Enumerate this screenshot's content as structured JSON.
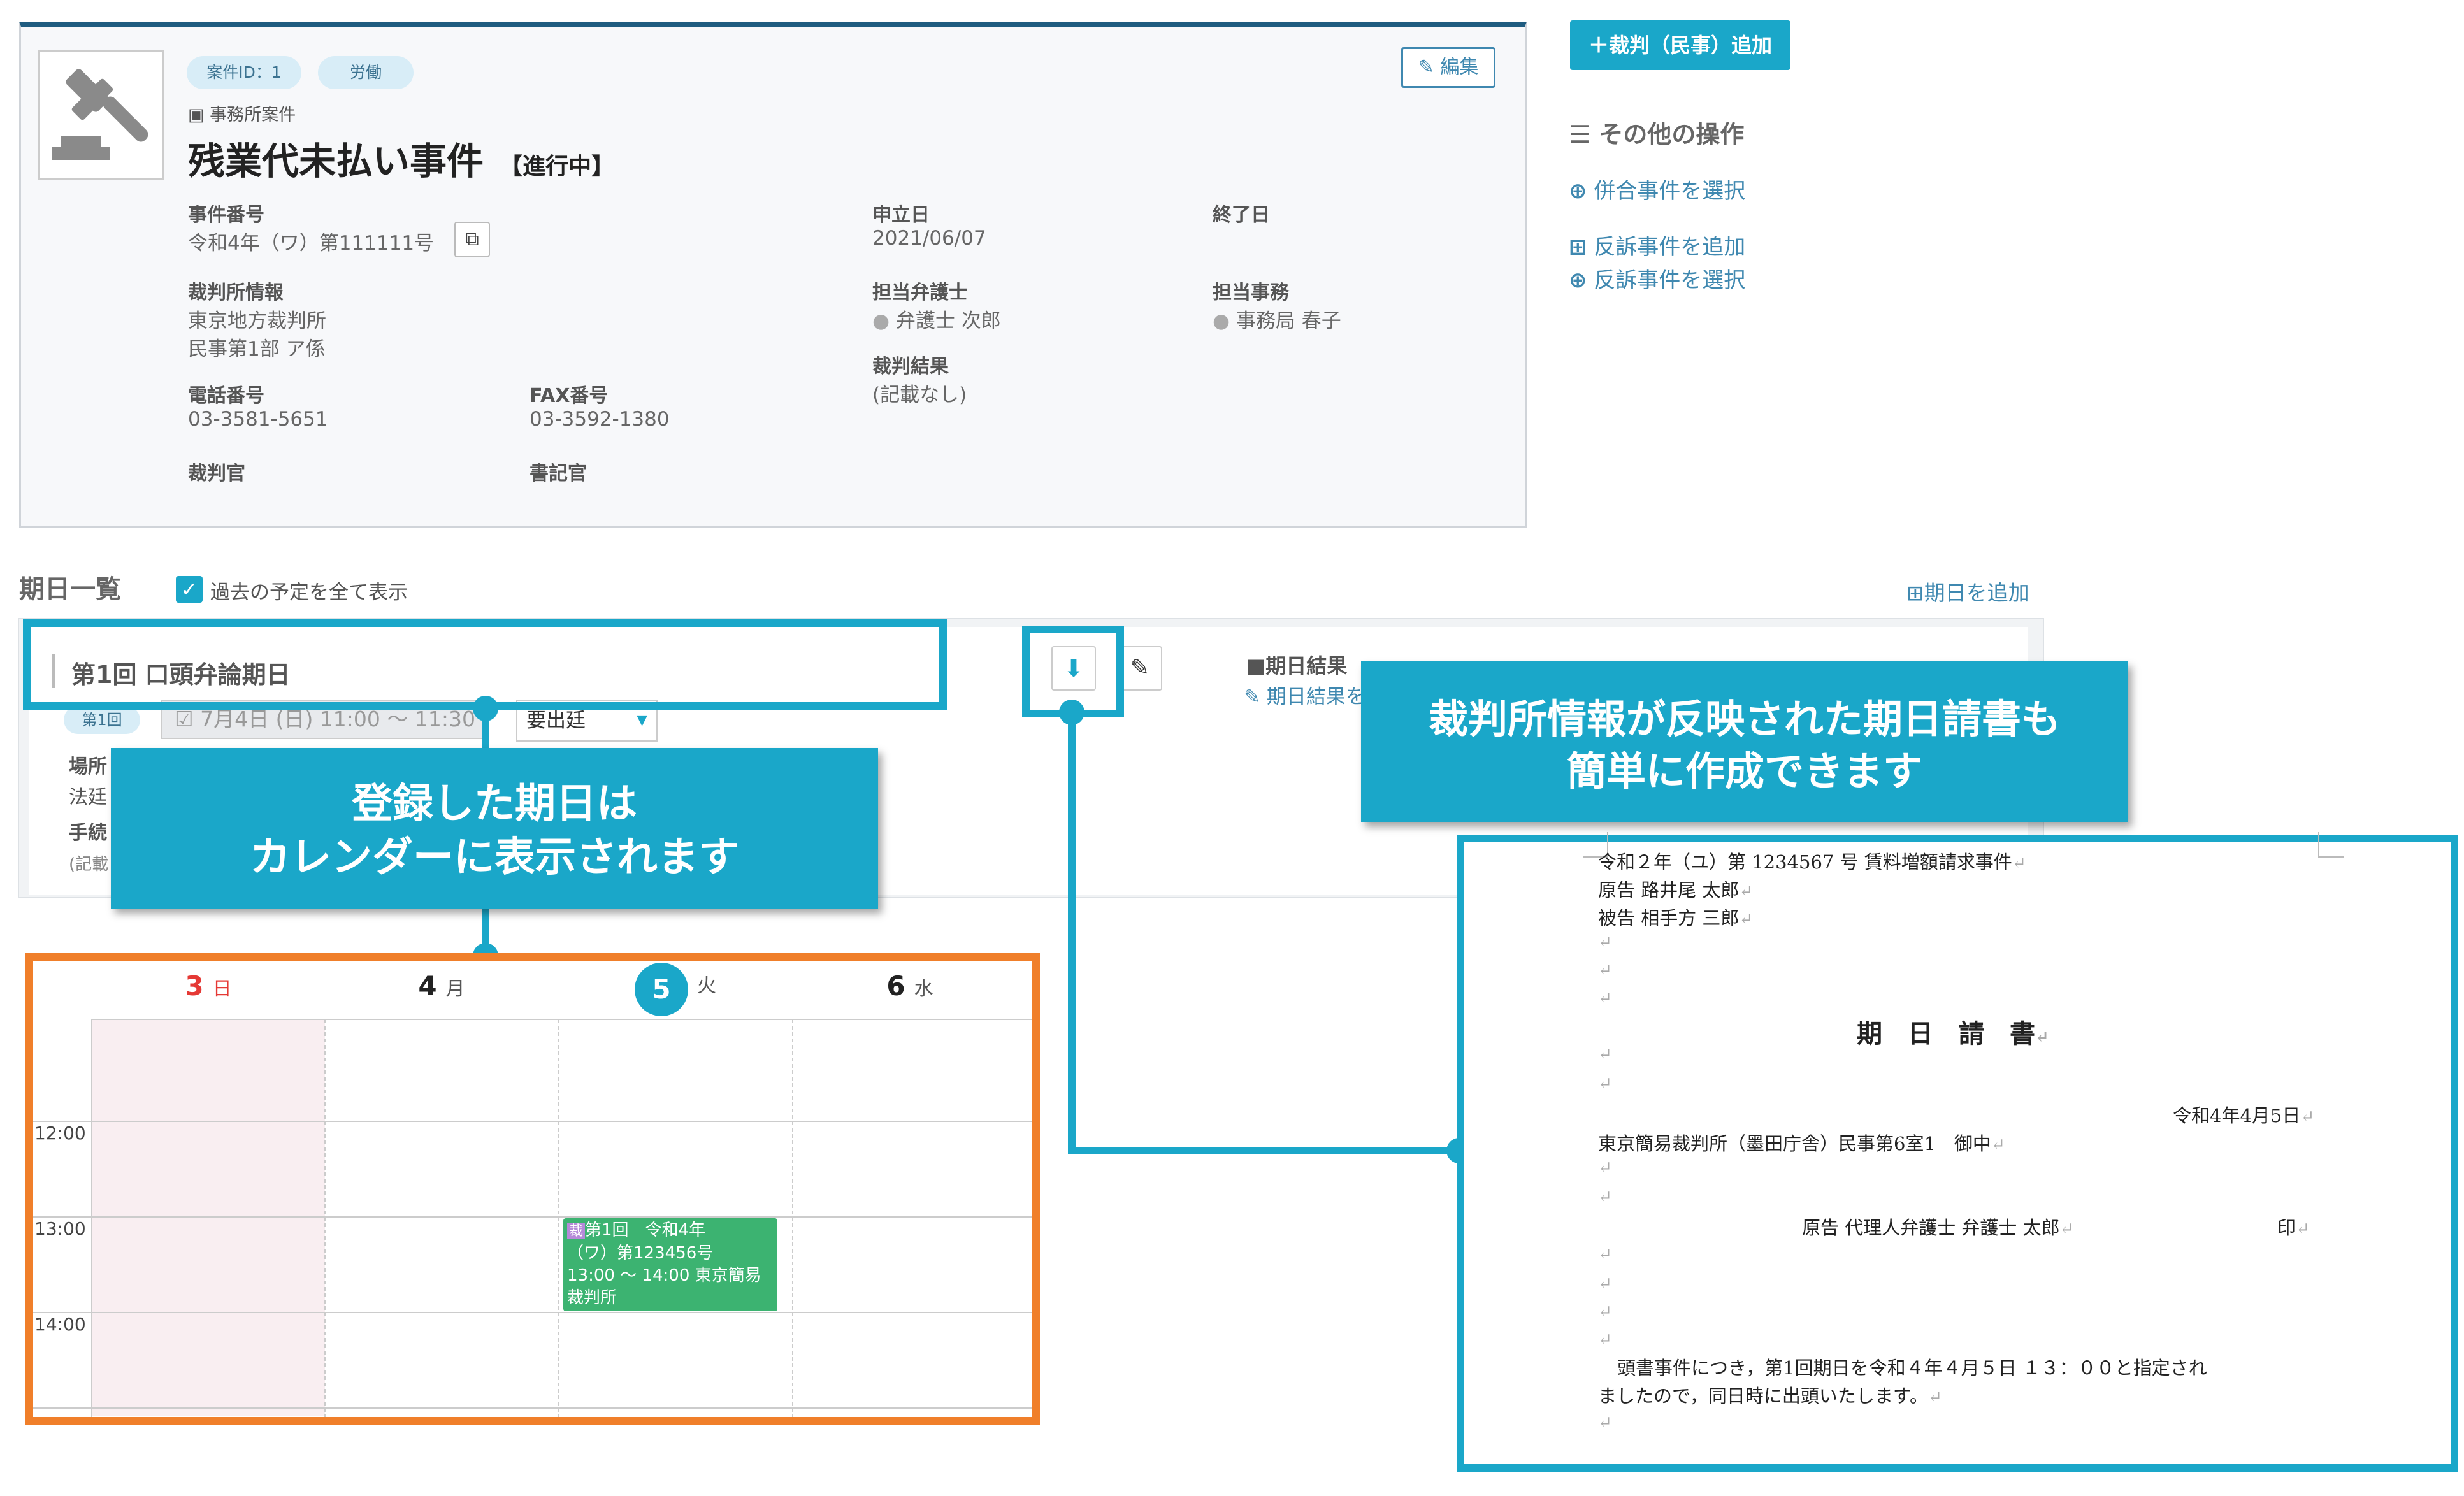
{
  "case": {
    "id_tag": "案件ID：1",
    "category_tag": "労働",
    "edit_label": "編集",
    "office_label": "事務所案件",
    "title": "残業代未払い事件",
    "status": "【進行中】",
    "fields": {
      "case_number_label": "事件番号",
      "case_number": "令和4年（ワ）第111111号",
      "filed_date_label": "申立日",
      "filed_date": "2021/06/07",
      "end_date_label": "終了日",
      "court_info_label": "裁判所情報",
      "court_name": "東京地方裁判所",
      "court_division": "民事第1部 ア係",
      "lawyer_label": "担当弁護士",
      "lawyer": "弁護士 次郎",
      "staff_label": "担当事務",
      "staff": "事務局 春子",
      "judgment_label": "裁判結果",
      "judgment": "(記載なし)",
      "phone_label": "電話番号",
      "phone": "03-3581-5651",
      "fax_label": "FAX番号",
      "fax": "03-3592-1380",
      "judge_label": "裁判官",
      "clerk_label": "書記官"
    }
  },
  "side": {
    "add_button": "裁判（民事）追加",
    "other_ops_title": "その他の操作",
    "select_joined": "併合事件を選択",
    "add_counter": "反訴事件を追加",
    "select_counter": "反訴事件を選択"
  },
  "schedule": {
    "title": "期日一覧",
    "show_past_label": "過去の予定を全て表示",
    "add_date_label": "期日を追加",
    "item_title": "第1回 口頭弁論期日",
    "round_badge": "第1回",
    "date_text": "7月4日 (日) 11:00 ～ 11:30",
    "attendance_select": "要出廷",
    "place_label": "場所",
    "place_value": "法廷",
    "procedure_label": "手続",
    "procedure_value": "(記載",
    "result_title": "■期日結果",
    "result_link": "期日結果を"
  },
  "callouts": {
    "calendar_line1": "登録した期日は",
    "calendar_line2": "カレンダーに表示されます",
    "document_line1": "裁判所情報が反映された期日請書も",
    "document_line2": "簡単に作成できます"
  },
  "calendar": {
    "days": [
      {
        "num": "3",
        "name": "日"
      },
      {
        "num": "4",
        "name": "月"
      },
      {
        "num": "5",
        "name": "火"
      },
      {
        "num": "6",
        "name": "水"
      }
    ],
    "times": [
      "12:00",
      "13:00",
      "14:00"
    ],
    "event_badge": "裁",
    "event_line1": "第1回　令和4年",
    "event_line2": "（ワ）第123456号",
    "event_line3": "13:00 ～ 14:00 東京簡易",
    "event_line4": "裁判所"
  },
  "document": {
    "line_case": "令和２年（ユ）第 1234567 号 賃料増額請求事件",
    "line_plaintiff": "原告  路井尾  太郎",
    "line_defendant": "被告  相手方  三郎",
    "heading": "期　日　請　書",
    "date": "令和4年4月5日",
    "court": "東京簡易裁判所（墨田庁舎）民事第6室1　御中",
    "signer": "原告  代理人弁護士  弁護士  太郎",
    "seal": "印",
    "body_line1": "頭書事件につき，第1回期日を令和４年４月５日 １３：００と指定され",
    "body_line2": "ましたので，同日時に出頭いたします。",
    "return_mark": "↵"
  },
  "colors": {
    "accent": "#1aa7c9",
    "calendar_border": "#f07f2a",
    "event": "#3cb371",
    "sunday": "#e53935",
    "header_stripe": "#1f5c80"
  }
}
